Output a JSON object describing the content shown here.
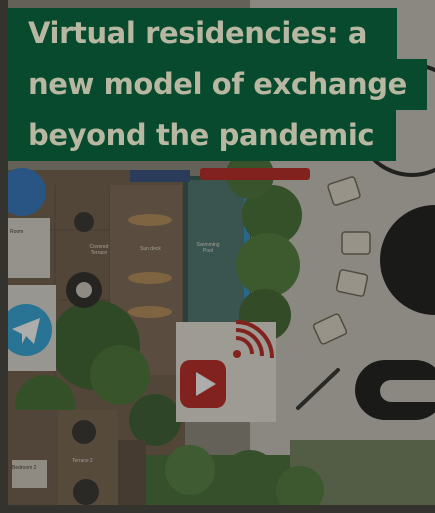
{
  "article": {
    "title_lines": [
      "Virtual residencies: a",
      "new model of exchange",
      "beyond the pandemic"
    ]
  },
  "plan_labels": {
    "room": "Room",
    "covered_terrace": "Covered Terrace",
    "sun_deck": "Sun deck",
    "swimming_pool": "Swimming Pool",
    "bedroom_2": "Bedroom 2",
    "terrace_2": "Terrace 2"
  },
  "colors": {
    "title_bg": "#084a2d",
    "title_text": "#b8b8a2",
    "telegram": "#2aa3d8",
    "youtube": "#c0201d"
  },
  "icons": [
    "telegram-icon",
    "youtube-icon",
    "pen-icon"
  ]
}
